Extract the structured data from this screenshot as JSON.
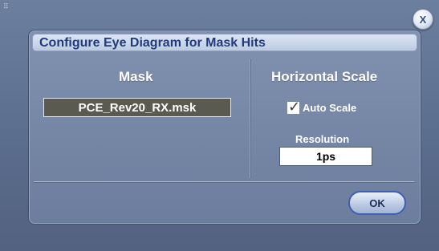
{
  "dialog": {
    "title": "Configure Eye Diagram for Mask Hits",
    "close_label": "X"
  },
  "mask": {
    "heading": "Mask",
    "file_value": "PCE_Rev20_RX.msk"
  },
  "horizontal_scale": {
    "heading": "Horizontal Scale",
    "auto_scale_label": "Auto Scale",
    "auto_scale_checked": true,
    "check_glyph": "✓",
    "resolution_label": "Resolution",
    "resolution_value": "1ps"
  },
  "actions": {
    "ok_label": "OK"
  },
  "colors": {
    "dialog_bg": "#7384a4",
    "title_text": "#223a7a",
    "field_bg": "#5b5a50",
    "ok_border": "#3e5fb4"
  }
}
